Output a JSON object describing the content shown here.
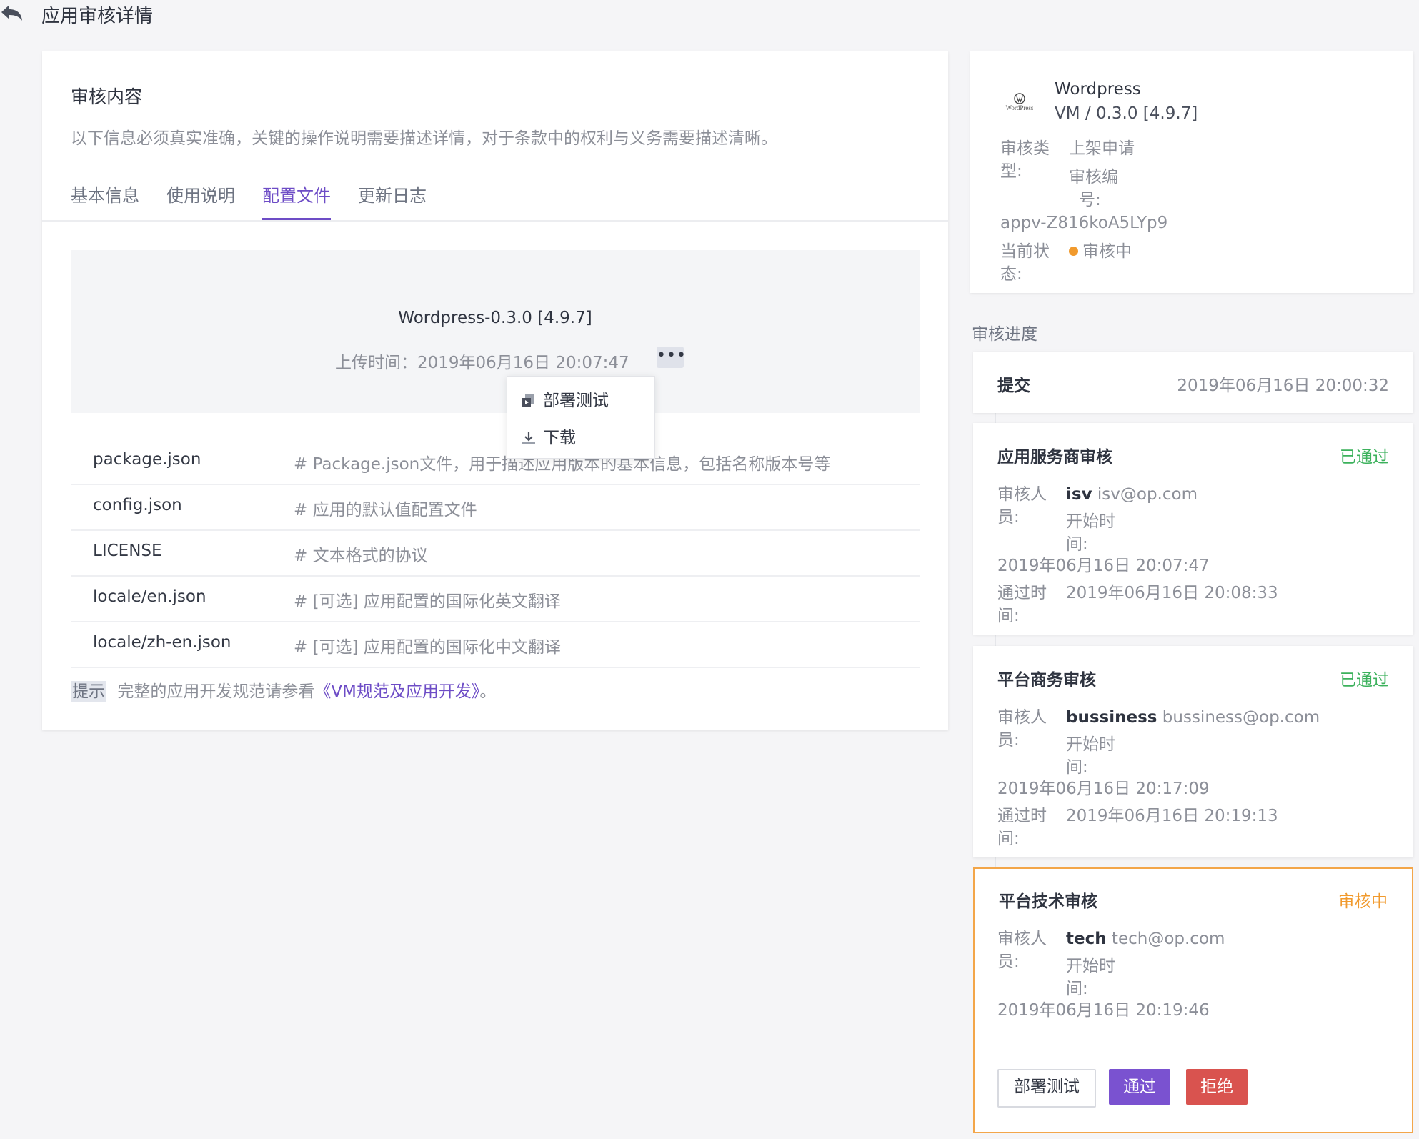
{
  "header": {
    "title": "应用审核详情"
  },
  "content": {
    "title": "审核内容",
    "description": "以下信息必须真实准确，关键的操作说明需要描述详情，对于条款中的权利与义务需要描述清晰。",
    "tabs": [
      {
        "label": "基本信息"
      },
      {
        "label": "使用说明"
      },
      {
        "label": "配置文件",
        "active": true
      },
      {
        "label": "更新日志"
      }
    ],
    "package": {
      "name": "Wordpress-0.3.0 [4.9.7]",
      "upload_label": "上传时间：",
      "upload_time": "2019年06月16日 20:07:47",
      "more": "•••"
    },
    "dropdown": [
      {
        "label": "部署测试",
        "icon": "deploy-icon"
      },
      {
        "label": "下载",
        "icon": "download-icon"
      }
    ],
    "files": [
      {
        "name": "package.json",
        "desc": "#  Package.json文件，用于描述应用版本的基本信息，包括名称版本号等"
      },
      {
        "name": "config.json",
        "desc": "#  应用的默认值配置文件"
      },
      {
        "name": "LICENSE",
        "desc": "#  文本格式的协议"
      },
      {
        "name": "locale/en.json",
        "desc": "#  [可选]  应用配置的国际化英文翻译"
      },
      {
        "name": "locale/zh-en.json",
        "desc": "#  [可选]  应用配置的国际化中文翻译"
      }
    ],
    "tip": {
      "badge": "提示",
      "text": "完整的应用开发规范请参看",
      "link": "《VM规范及应用开发》",
      "suffix": "。"
    }
  },
  "app_info": {
    "logo_text": "WordPress",
    "name": "Wordpress",
    "version": "VM / 0.3.0 [4.9.7]",
    "type_label_1": "审核类",
    "type_label_2": "型:",
    "type_value": "上架申请",
    "id_label_1": "审核编",
    "id_label_2": "号:",
    "id_value": "appv-Z816koA5LYp9",
    "status_label_1": "当前状",
    "status_label_2": "态:",
    "status_value": "审核中",
    "status_color": "#f19a2d"
  },
  "progress": {
    "label": "审核进度",
    "submit": {
      "title": "提交",
      "time": "2019年06月16日 20:00:32"
    },
    "steps": [
      {
        "title": "应用服务商审核",
        "status": "已通过",
        "reviewer_label_1": "审核人",
        "reviewer_label_2": "员:",
        "reviewer_name": "isv",
        "reviewer_email": "isv@op.com",
        "start_label_1": "开始时",
        "start_label_2": "间:",
        "start_time": "2019年06月16日 20:07:47",
        "pass_label_1": "通过时",
        "pass_label_2": "间:",
        "pass_time": "2019年06月16日 20:08:33"
      },
      {
        "title": "平台商务审核",
        "status": "已通过",
        "reviewer_label_1": "审核人",
        "reviewer_label_2": "员:",
        "reviewer_name": "bussiness",
        "reviewer_email": "bussiness@op.com",
        "start_label_1": "开始时",
        "start_label_2": "间:",
        "start_time": "2019年06月16日 20:17:09",
        "pass_label_1": "通过时",
        "pass_label_2": "间:",
        "pass_time": "2019年06月16日 20:19:13"
      },
      {
        "title": "平台技术审核",
        "status": "审核中",
        "reviewer_label_1": "审核人",
        "reviewer_label_2": "员:",
        "reviewer_name": "tech",
        "reviewer_email": "tech@op.com",
        "start_label_1": "开始时",
        "start_label_2": "间:",
        "start_time": "2019年06月16日 20:19:46"
      }
    ],
    "actions": {
      "deploy": "部署测试",
      "approve": "通过",
      "reject": "拒绝"
    },
    "colors": {
      "passed": "#3cb15c",
      "pending": "#f19a2d",
      "primary": "#7a52d0",
      "danger": "#d9534f"
    }
  }
}
